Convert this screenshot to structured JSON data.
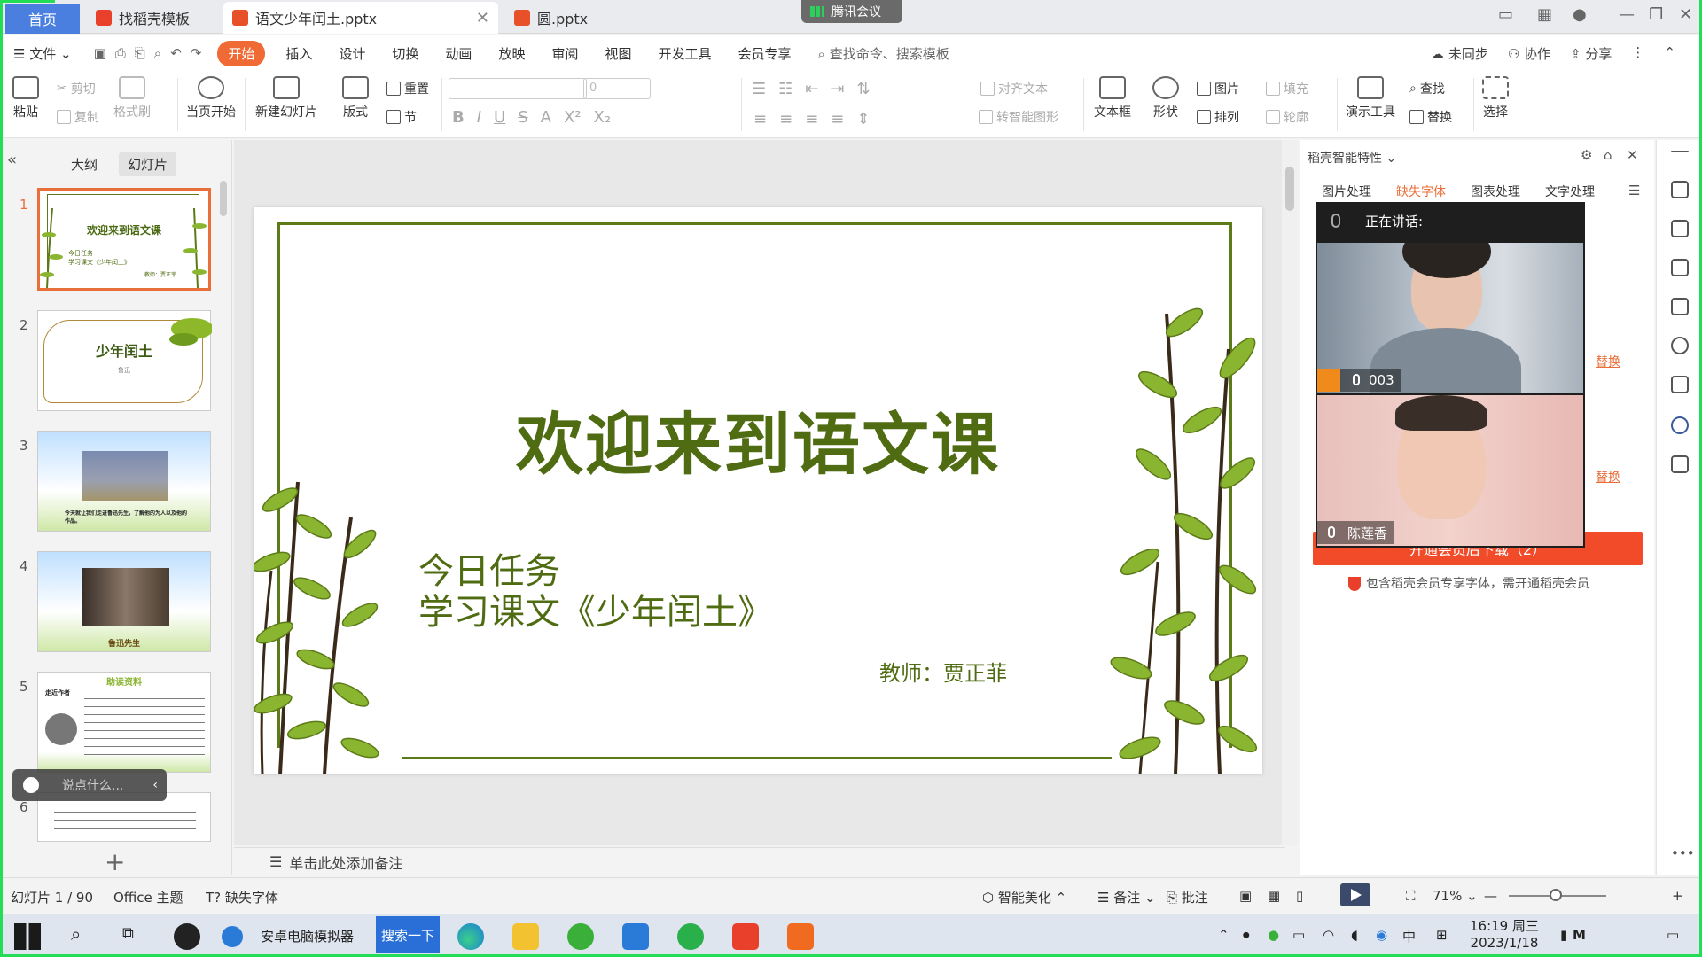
{
  "titlebar": {
    "tabs": [
      {
        "label": "首页"
      },
      {
        "label": "找稻壳模板"
      },
      {
        "label": "语文少年闰土.pptx"
      },
      {
        "label": "圆.pptx"
      }
    ],
    "meeting_label": "腾讯会议"
  },
  "menubar": {
    "file": "文件",
    "items": [
      "开始",
      "插入",
      "设计",
      "切换",
      "动画",
      "放映",
      "审阅",
      "视图",
      "开发工具",
      "会员专享"
    ],
    "search": "查找命令、搜索模板",
    "right": [
      "未同步",
      "协作",
      "分享"
    ]
  },
  "ribbon": {
    "paste": "粘贴",
    "cut": "剪切",
    "copy": "复制",
    "format_painter": "格式刷",
    "from_current": "当页开始",
    "new_slide": "新建幻灯片",
    "layout": "版式",
    "reset": "重置",
    "section": "节",
    "font_size": "0",
    "align_text": "对齐文本",
    "smart_art": "转智能图形",
    "textbox": "文本框",
    "shape": "形状",
    "picture": "图片",
    "arrange": "排列",
    "fill": "填充",
    "outline": "轮廓",
    "presenter_tools": "演示工具",
    "find": "查找",
    "replace": "替换",
    "select": "选择"
  },
  "slidepanel": {
    "tabs": [
      "大纲",
      "幻灯片"
    ],
    "thumbs": [
      {
        "num": "1",
        "title": "欢迎来到语文课",
        "sub1": "今日任务",
        "sub2": "学习课文《少年闰土》",
        "teacher": "教师：贾正菲"
      },
      {
        "num": "2",
        "title": "少年闰土",
        "sub": "鲁迅"
      },
      {
        "num": "3",
        "caption": "今天就让我们走进鲁迅先生，了解他的为人以及他的作品。"
      },
      {
        "num": "4",
        "caption": "鲁迅先生"
      },
      {
        "num": "5",
        "title": "助读资料",
        "tag": "走近作者"
      },
      {
        "num": "6",
        "caption": ""
      }
    ],
    "chat_placeholder": "说点什么..."
  },
  "slide": {
    "title": "欢迎来到语文课",
    "line1": "今日任务",
    "line2": "学习课文《少年闰土》",
    "teacher": "教师：贾正菲"
  },
  "notes_placeholder": "单击此处添加备注",
  "taskpane": {
    "header": "稻壳智能特性",
    "tabs": [
      "图片处理",
      "缺失字体",
      "图表处理",
      "文字处理"
    ],
    "replace": "替换",
    "button": "开通会员后下载（2）",
    "vip_note": "包含稻壳会员专享字体，需开通稻壳会员"
  },
  "meeting": {
    "speaking": "正在讲话:",
    "participants": [
      "003",
      "陈莲香"
    ]
  },
  "statusbar": {
    "slide_pos": "幻灯片 1 / 90",
    "theme": "Office 主题",
    "missing_font": "缺失字体",
    "beautify": "智能美化",
    "notes": "备注",
    "comments": "批注",
    "zoom": "71%"
  },
  "taskbar": {
    "emulator": "安卓电脑模拟器",
    "search_btn": "搜索一下",
    "ime": "中",
    "time": "16:19 周三",
    "date": "2023/1/18"
  }
}
